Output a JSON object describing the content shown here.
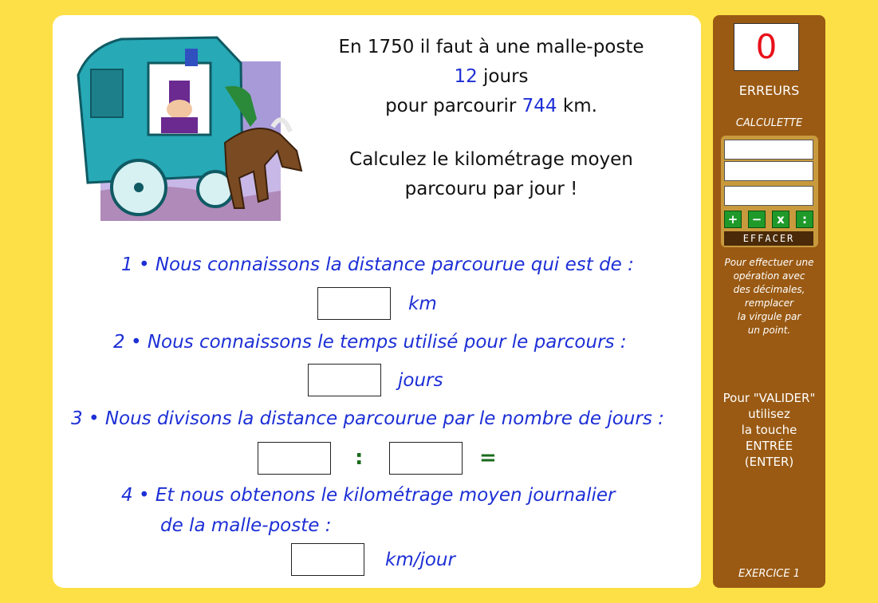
{
  "problem": {
    "line1": "En 1750 il faut à une malle-poste",
    "days_value": "12",
    "days_word": " jours",
    "line3_prefix": "pour parcourir ",
    "distance_value": "744",
    "line3_suffix": " km.",
    "question_line1": "Calculez le kilométrage moyen",
    "question_line2": "parcouru par jour !"
  },
  "steps": {
    "s1": "1 • Nous connaissons la distance parcourue qui est de :",
    "s1_unit": "km",
    "s2": "2 • Nous connaissons le temps utilisé pour le parcours :",
    "s2_unit": "jours",
    "s3": "3 • Nous divisons la distance parcourue par le nombre de jours :",
    "s3_divide": ":",
    "s3_equals": "=",
    "s4_line1": "4 • Et nous obtenons le kilométrage moyen journalier",
    "s4_line2": "de la malle-poste :",
    "s4_unit": "km/jour"
  },
  "sidebar": {
    "errors_count": "0",
    "errors_label": "ERREURS",
    "calc_title": "CALCULETTE",
    "btn_plus": "+",
    "btn_minus": "−",
    "btn_times": "x",
    "btn_divide": ":",
    "clear_label": "EFFACER",
    "note_lines": [
      "Pour effectuer une",
      "opération avec",
      "des décimales,",
      "remplacer",
      "la virgule par",
      "un point."
    ],
    "valider_lines": [
      "Pour \"VALIDER\"",
      "utilisez",
      "la touche",
      "ENTRÉE",
      "(ENTER)"
    ],
    "exercise_label": "EXERCICE 1"
  },
  "colors": {
    "background": "#fde047",
    "sidebar": "#9a5a13",
    "accent_blue": "#1d2fd6",
    "error_red": "#e8101a",
    "calc_green": "#1f9a2a"
  },
  "icons": {
    "illustration": "stagecoach-illustration"
  }
}
